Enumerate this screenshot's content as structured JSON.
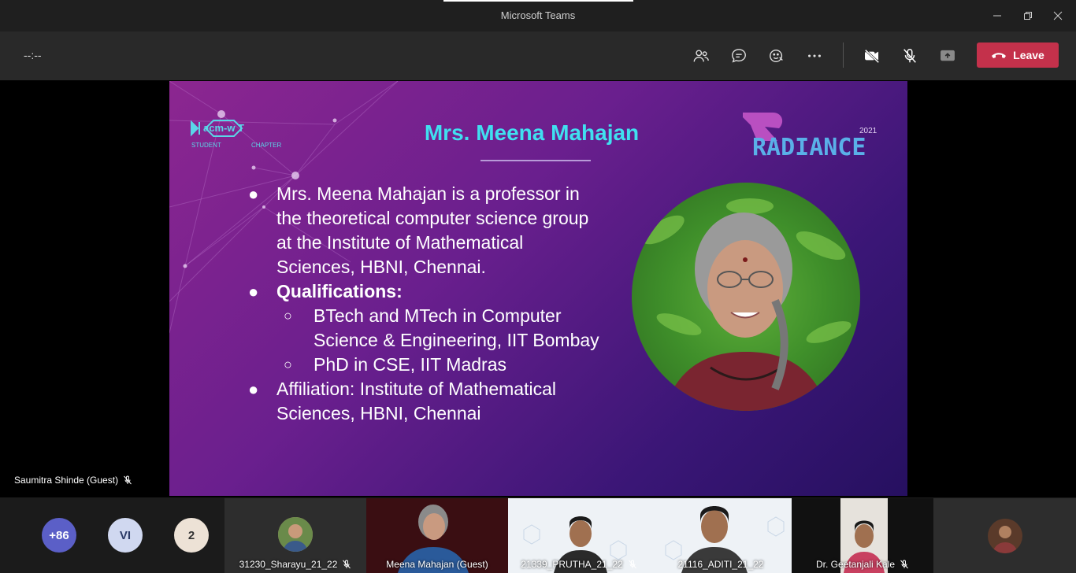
{
  "window": {
    "title": "Microsoft Teams"
  },
  "toolbar": {
    "timer": "--:--",
    "leave_label": "Leave"
  },
  "slide": {
    "logo_text": "acm-w T",
    "logo_sub_left": "STUDENT",
    "logo_sub_right": "CHAPTER",
    "brand": "RADIANCE",
    "brand_year": "2021",
    "title": "Mrs. Meena Mahajan",
    "bullets": [
      {
        "level": 1,
        "bold": false,
        "lines": [
          "Mrs. Meena Mahajan is a professor in",
          "the theoretical computer science group",
          "at the Institute of Mathematical",
          "Sciences, HBNI, Chennai."
        ]
      },
      {
        "level": 1,
        "bold": true,
        "lines": [
          "Qualifications:"
        ]
      },
      {
        "level": 2,
        "bold": false,
        "lines": [
          "BTech and MTech in Computer",
          "Science & Engineering, IIT Bombay"
        ]
      },
      {
        "level": 2,
        "bold": false,
        "lines": [
          "PhD in CSE, IIT Madras"
        ]
      },
      {
        "level": 1,
        "bold": false,
        "lines": [
          "Affiliation: Institute of Mathematical",
          "Sciences, HBNI, Chennai"
        ]
      }
    ]
  },
  "speaker": {
    "name": "Saumitra Shinde (Guest)"
  },
  "participants": {
    "overflow_bubbles": [
      {
        "label": "+86",
        "color": "#5b5fc7"
      },
      {
        "label": "VI",
        "color": "#d0d8f0"
      },
      {
        "label": "2",
        "color": "#ede2d6"
      }
    ],
    "tiles": [
      {
        "name": "31230_Sharayu_21_22"
      },
      {
        "name": "Meena Mahajan (Guest)"
      },
      {
        "name": "21339_PRUTHA_21_22"
      },
      {
        "name": "21116_ADITI_21_22"
      },
      {
        "name": "Dr. Geetanjali Kale"
      }
    ]
  },
  "colors": {
    "leave": "#c4314b",
    "title_cyan": "#40e0f0",
    "slide_bg_start": "#8c2690",
    "slide_bg_end": "#261060"
  }
}
